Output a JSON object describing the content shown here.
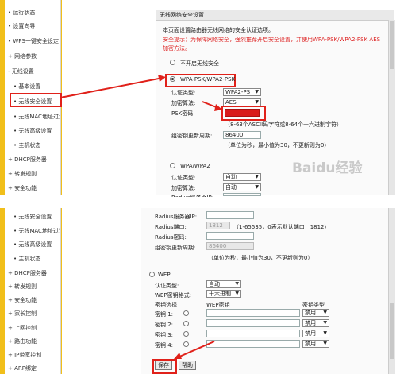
{
  "top": {
    "sidebar_items": [
      "• 运行状态",
      "• 设置向导",
      "• WPS一键安全设定",
      "+ 网络参数",
      "- 无线设置",
      "• 基本设置",
      "• 无线安全设置",
      "• 无线MAC地址过滤",
      "• 无线高级设置",
      "• 主机状态",
      "+ DHCP服务器",
      "+ 转发规则",
      "+ 安全功能"
    ],
    "title": "无线网络安全设置",
    "intro": "本页面设置路由器无线网络的安全认证选项。",
    "tip_line1": "安全提示：为保障网络安全，强烈推荐开启安全设置，并使用WPA-PSK/WPA2-PSK AES",
    "tip_line2": "加密方法。",
    "opt_off": "不开启无线安全",
    "opt_wpa_psk": "WPA-PSK/WPA2-PSK",
    "auth_label": "认证类型:",
    "auth_value": "WPA2-PS",
    "enc_label": "加密算法:",
    "enc_value": "AES",
    "psk_label": "PSK密码:",
    "psk_hint": "（8-63个ASCII码字符或8-64个十六进制字符）",
    "renew_label": "组密钥更新周期:",
    "renew_value": "86400",
    "renew_hint": "（单位为秒，最小值为30，不更新则为0）",
    "opt_wpa": "WPA/WPA2",
    "auth2_label": "认证类型:",
    "auth2_value": "自动",
    "enc2_label": "加密算法:",
    "enc2_value": "自动",
    "radius_ip_label": "Radius服务器IP:"
  },
  "bottom": {
    "sidebar_items": [
      "• 无线安全设置",
      "• 无线MAC地址过滤",
      "• 无线高级设置",
      "• 主机状态",
      "+ DHCP服务器",
      "+ 转发规则",
      "+ 安全功能",
      "+ 家长控制",
      "+ 上网控制",
      "+ 路由功能",
      "+ IP带宽控制",
      "+ ARP绑定"
    ],
    "radius_ip_label": "Radius服务器IP:",
    "radius_port_label": "Radius端口:",
    "radius_port_value": "1812",
    "radius_port_hint": "（1-65535，0表示默认端口：1812）",
    "radius_pwd_label": "Radius密码:",
    "renew_label": "组密钥更新周期:",
    "renew_value": "86400",
    "renew_hint": "（单位为秒，最小值为30，不更新则为0）",
    "opt_wep": "WEP",
    "auth_label": "认证类型:",
    "auth_value": "自动",
    "format_label": "WEP密钥格式:",
    "format_value": "十六进制",
    "key_sel_header": "密钥选择",
    "wep_key_header": "WEP密钥",
    "key_type_header": "密钥类型",
    "keys": [
      {
        "label": "密钥 1:",
        "type": "禁用"
      },
      {
        "label": "密钥 2:",
        "type": "禁用"
      },
      {
        "label": "密钥 3:",
        "type": "禁用"
      },
      {
        "label": "密钥 4:",
        "type": "禁用"
      }
    ],
    "save_label": "保存",
    "help_label": "帮助"
  },
  "watermark": "Baidu经验",
  "colors": {
    "sidebar": "#f1bf1a",
    "annotation": "#e0211a"
  }
}
